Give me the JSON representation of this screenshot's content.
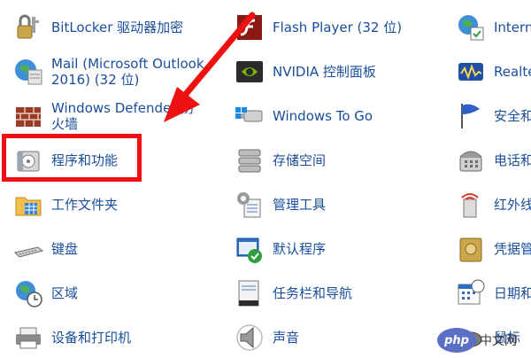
{
  "items": {
    "bitlocker": "BitLocker 驱动器加密",
    "mail": "Mail (Microsoft Outlook 2016) (32 位)",
    "defender": "Windows Defender 防火墙",
    "programs": "程序和功能",
    "work_folders": "工作文件夹",
    "keyboard": "键盘",
    "region": "区域",
    "devices_printers": "设备和打印机",
    "flash": "Flash Player (32 位)",
    "nvidia": "NVIDIA 控制面板",
    "windows_to_go": "Windows To Go",
    "storage_spaces": "存储空间",
    "admin_tools": "管理工具",
    "default_programs": "默认程序",
    "taskbar_nav": "任务栏和导航",
    "sound": "声音",
    "internet": "Intern",
    "realtek": "Realte",
    "security": "安全和",
    "phone_modem": "电话和",
    "infrared": "红外线",
    "credential": "凭据管",
    "date_time": "日期和",
    "mouse": "鼠标"
  },
  "watermark": {
    "logo": "php",
    "text": "中文网"
  },
  "colors": {
    "link": "#1a4e9c",
    "highlight": "#ee1111"
  }
}
